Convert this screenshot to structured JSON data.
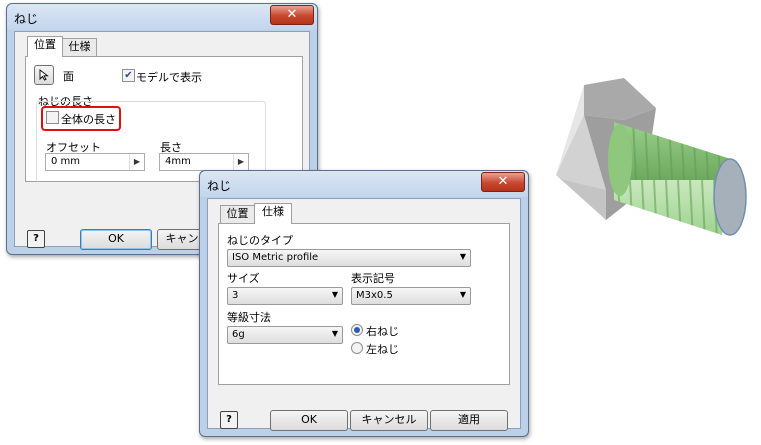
{
  "dialog_back": {
    "title": "ねじ",
    "close_label": "✕",
    "tabs": [
      "位置",
      "仕様"
    ],
    "face_label": "面",
    "show_in_model_label": "モデルで表示",
    "show_in_model_checked": true,
    "thread_length_group": "ねじの長さ",
    "full_length_label": "全体の長さ",
    "full_length_checked": false,
    "offset_label": "オフセット",
    "offset_value": "0 mm",
    "length_label": "長さ",
    "length_value": "4mm",
    "ok_label": "OK",
    "cancel_label": "キャンセル"
  },
  "dialog_front": {
    "title": "ねじ",
    "close_label": "✕",
    "tabs": [
      "位置",
      "仕様"
    ],
    "thread_type_label": "ねじのタイプ",
    "thread_type_value": "ISO Metric profile",
    "size_label": "サイズ",
    "size_value": "3",
    "designation_label": "表示記号",
    "designation_value": "M3x0.5",
    "class_label": "等級寸法",
    "class_value": "6g",
    "right_hand_label": "右ねじ",
    "left_hand_label": "左ねじ",
    "right_hand_selected": true,
    "ok_label": "OK",
    "cancel_label": "キャンセル",
    "apply_label": "適用",
    "help_label": "?"
  },
  "colors": {
    "thread_green": "#9bd18c",
    "bolt_grey": "#b8b8b8",
    "highlight_red": "#e01010"
  }
}
